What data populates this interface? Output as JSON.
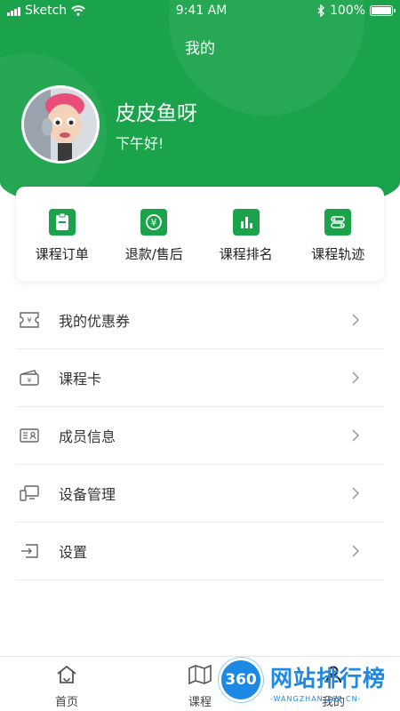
{
  "status_bar": {
    "carrier": "Sketch",
    "time": "9:41 AM",
    "battery": "100%"
  },
  "header": {
    "title": "我的"
  },
  "profile": {
    "name": "皮皮鱼呀",
    "greeting": "下午好!"
  },
  "quick_actions": [
    {
      "label": "课程订单",
      "icon": "order-icon"
    },
    {
      "label": "退款/售后",
      "icon": "refund-icon"
    },
    {
      "label": "课程排名",
      "icon": "ranking-icon"
    },
    {
      "label": "课程轨迹",
      "icon": "track-icon"
    }
  ],
  "menu": [
    {
      "label": "我的优惠券",
      "icon": "coupon-icon"
    },
    {
      "label": "课程卡",
      "icon": "course-card-icon"
    },
    {
      "label": "成员信息",
      "icon": "member-card-icon"
    },
    {
      "label": "设备管理",
      "icon": "device-icon"
    },
    {
      "label": "设置",
      "icon": "settings-icon"
    }
  ],
  "tab_bar": [
    {
      "label": "首页",
      "icon": "home-icon"
    },
    {
      "label": "课程",
      "icon": "map-icon"
    },
    {
      "label": "我的",
      "icon": "profile-icon"
    }
  ],
  "watermark": {
    "badge": "360",
    "text": "网站排行榜",
    "sub": "-WANGZHAN.360.CN-"
  },
  "colors": {
    "brand_green": "#1aa34a",
    "text": "#333333"
  }
}
